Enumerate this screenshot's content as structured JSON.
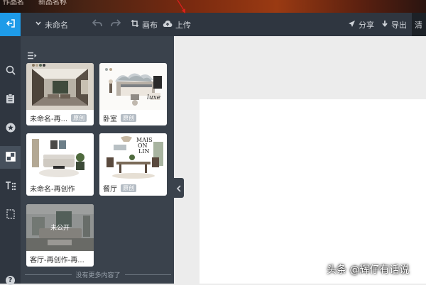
{
  "top_strip": {
    "left_text": "作品名",
    "mid_text": "新品名称"
  },
  "toolbar": {
    "doc_name": "未命名",
    "canvas_label": "画布",
    "upload_label": "上传",
    "share_label": "分享",
    "export_label": "导出",
    "clear_label": "清"
  },
  "sidebar": {
    "icons": [
      "exit-icon",
      "search-icon",
      "clipboard-icon",
      "star-icon",
      "template-icon",
      "text-effect-icon",
      "crop-frame-icon",
      "help-icon"
    ],
    "help_label": "?"
  },
  "panel": {
    "cards": [
      {
        "title": "未命名-再...",
        "badge": "原创"
      },
      {
        "title": "卧室",
        "badge": "原创"
      },
      {
        "title": "未命名-再创作",
        "badge": ""
      },
      {
        "title": "餐厅",
        "badge": "原创"
      },
      {
        "title": "客厅-再创作-再...",
        "badge": "",
        "overlay": "未公开"
      }
    ],
    "thumb_texts": {
      "luxe": "luxe",
      "maison_1": "MAIS",
      "maison_2": "ON",
      "maison_3": "LIN"
    },
    "no_more": "没有更多内容了"
  },
  "watermark": "头条 @辉仔有话说",
  "colors": {
    "accent": "#1e9be8",
    "toolbar": "#2f3640",
    "panel": "#3a424c"
  }
}
